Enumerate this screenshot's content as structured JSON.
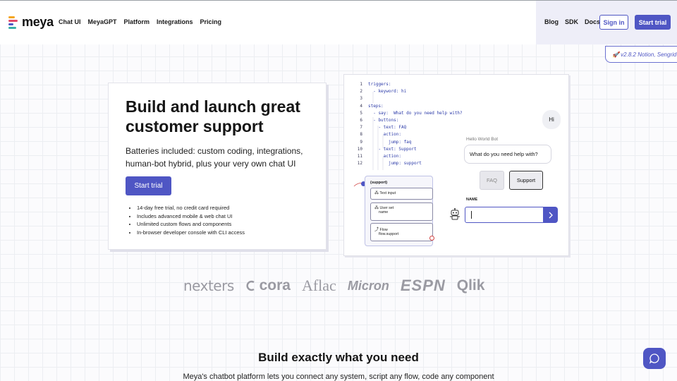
{
  "brand": {
    "name": "meya",
    "bar_colors": [
      "#f4a623",
      "#e24b6b",
      "#4f56c4",
      "#3ab0a8"
    ],
    "accent": "#4f56c4"
  },
  "nav": {
    "left": [
      "Chat UI",
      "MeyaGPT",
      "Platform",
      "Integrations",
      "Pricing"
    ],
    "right": [
      "Blog",
      "SDK",
      "Docs"
    ],
    "sign_in": "Sign in",
    "start_trial": "Start trial"
  },
  "version_badge": "🚀 v2.8.2 Notion, Sengrid",
  "hero": {
    "title": "Build and launch great customer support",
    "subtitle": "Batteries included: custom coding, integrations, human-bot hybrid, plus your very own chat UI",
    "cta": "Start trial",
    "bullets": [
      "14-day free trial, no credit card required",
      "Includes advanced mobile & web chat UI",
      "Unlimited custom flows and components",
      "In-browser developer console with CLI access"
    ]
  },
  "demo": {
    "code": [
      {
        "n": "1",
        "t": "triggers:"
      },
      {
        "n": "2",
        "t": "  - keyword: hi"
      },
      {
        "n": "3",
        "t": ""
      },
      {
        "n": "4",
        "t": "steps:"
      },
      {
        "n": "5",
        "t": "  - say:  What do you need help with?"
      },
      {
        "n": "6",
        "t": "  - buttons:"
      },
      {
        "n": "7",
        "t": "    - text: FAQ"
      },
      {
        "n": "8",
        "t": "      action:"
      },
      {
        "n": "9",
        "t": "        jump: faq"
      },
      {
        "n": "10",
        "t": "    - text: Support"
      },
      {
        "n": "11",
        "t": "      action:"
      },
      {
        "n": "12",
        "t": "        jump: support"
      }
    ],
    "user_msg": "Hi",
    "bot_name": "Hello World Bot",
    "bot_msg": "What do you need help with?",
    "option_faq": "FAQ",
    "option_support": "Support",
    "name_label": "NAME",
    "flow": {
      "title": "(support)",
      "nodes": [
        {
          "icon": "⁂",
          "label": "Text input",
          "sub": ""
        },
        {
          "icon": "⁂",
          "label": "User set",
          "sub": "name"
        },
        {
          "icon": "⤴",
          "label": "Flow",
          "sub": "flow.support"
        }
      ]
    }
  },
  "logos": [
    "nexters",
    "cora",
    "Aflac",
    "Micron",
    "ESPN",
    "Qlik"
  ],
  "section": {
    "title": "Build exactly what you need",
    "subtitle": "Meya's chatbot platform lets you connect any system, script any flow, code any component"
  }
}
